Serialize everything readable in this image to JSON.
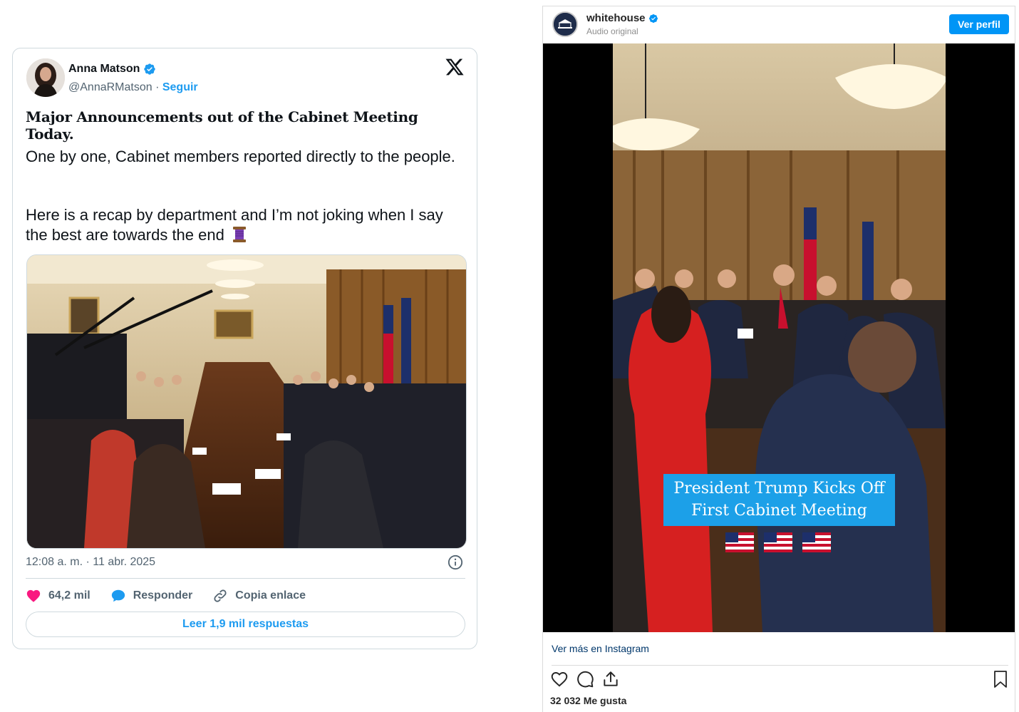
{
  "tweet": {
    "author_name": "Anna Matson",
    "author_handle": "@AnnaRMatson",
    "separator": " · ",
    "follow_label": "Seguir",
    "headline": "Major Announcements out of the Cabinet Meeting Today.",
    "paragraph_1": "One by one, Cabinet members reported directly to the people.",
    "paragraph_2": "Here is a recap by department and I’m not joking when I say the best are towards the end",
    "timestamp": "12:08 a. m. · 11 abr. 2025",
    "likes": "64,2 mil",
    "reply_label": "Responder",
    "copy_link_label": "Copia enlace",
    "read_replies_label": "Leer 1,9 mil respuestas",
    "accent_color": "#1d9bf0",
    "like_color": "#f91880"
  },
  "instagram": {
    "username": "whitehouse",
    "audio_label": "Audio original",
    "profile_button": "Ver perfil",
    "video_caption_line1": "President Trump Kicks Off",
    "video_caption_line2": "First Cabinet Meeting",
    "view_more": "Ver más en Instagram",
    "likes": "32 032 Me gusta",
    "accent_color": "#0095f6"
  }
}
